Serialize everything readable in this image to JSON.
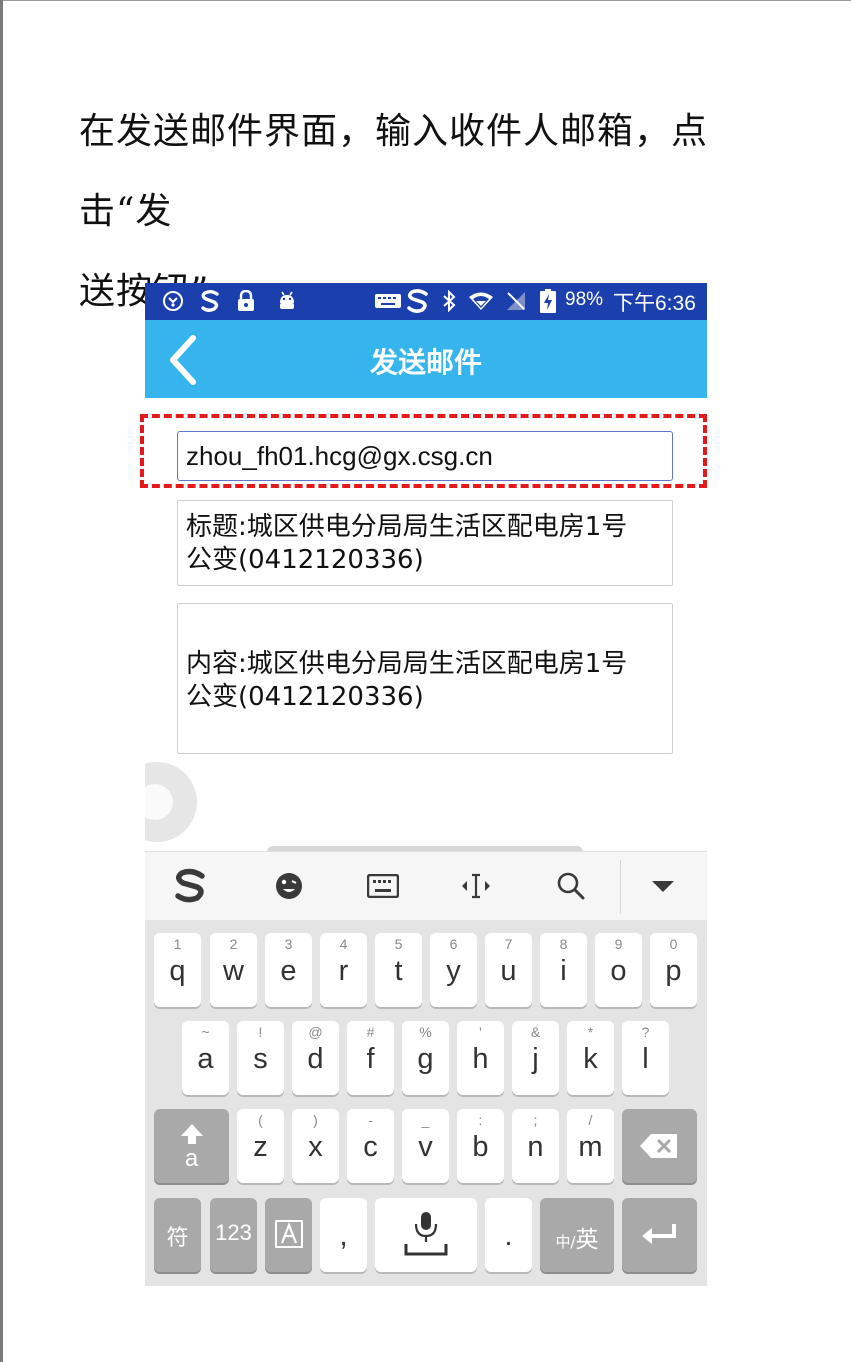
{
  "instruction": {
    "line1": "在发送邮件界面，输入收件人邮箱，点击“发",
    "line2": "送按钮”"
  },
  "status_bar": {
    "battery": "98%",
    "time_prefix": "下午",
    "time": "6:36",
    "icons": [
      "radar-icon",
      "sogou-icon",
      "lock-icon",
      "android-icon",
      "keyboard-icon",
      "sogou-icon",
      "bluetooth-icon",
      "wifi-icon",
      "no-sim-icon",
      "battery-charging-icon"
    ]
  },
  "header": {
    "title": "发送邮件"
  },
  "form": {
    "email": "zhou_fh01.hcg@gx.csg.cn",
    "subject_line1": "标题:城区供电分局局生活区配电房1号",
    "subject_line2": "公变(0412120336)",
    "content_line1": "内容:城区供电分局局生活区配电房1号",
    "content_line2": "公变(0412120336)"
  },
  "toolbar": {
    "icons": [
      "sogou-logo-icon",
      "emoji-icon",
      "keyboard-icon",
      "cursor-move-icon",
      "search-icon",
      "collapse-icon"
    ]
  },
  "keyboard": {
    "row1": [
      {
        "num": "1",
        "ch": "q"
      },
      {
        "num": "2",
        "ch": "w"
      },
      {
        "num": "3",
        "ch": "e"
      },
      {
        "num": "4",
        "ch": "r"
      },
      {
        "num": "5",
        "ch": "t"
      },
      {
        "num": "6",
        "ch": "y"
      },
      {
        "num": "7",
        "ch": "u"
      },
      {
        "num": "8",
        "ch": "i"
      },
      {
        "num": "9",
        "ch": "o"
      },
      {
        "num": "0",
        "ch": "p"
      }
    ],
    "row2": [
      {
        "num": "~",
        "ch": "a"
      },
      {
        "num": "!",
        "ch": "s"
      },
      {
        "num": "@",
        "ch": "d"
      },
      {
        "num": "#",
        "ch": "f"
      },
      {
        "num": "%",
        "ch": "g"
      },
      {
        "num": "'",
        "ch": "h"
      },
      {
        "num": "&",
        "ch": "j"
      },
      {
        "num": "*",
        "ch": "k"
      },
      {
        "num": "?",
        "ch": "l"
      }
    ],
    "row3": [
      {
        "num": "(",
        "ch": "z"
      },
      {
        "num": ")",
        "ch": "x"
      },
      {
        "num": "-",
        "ch": "c"
      },
      {
        "num": "_",
        "ch": "v"
      },
      {
        "num": ":",
        "ch": "b"
      },
      {
        "num": ";",
        "ch": "n"
      },
      {
        "num": "/",
        "ch": "m"
      }
    ],
    "shift_letter": "a",
    "symbols_label": "符",
    "numbers_label": "123",
    "comma": ",",
    "period": ".",
    "lang_small": "中/",
    "lang_big": "英"
  }
}
